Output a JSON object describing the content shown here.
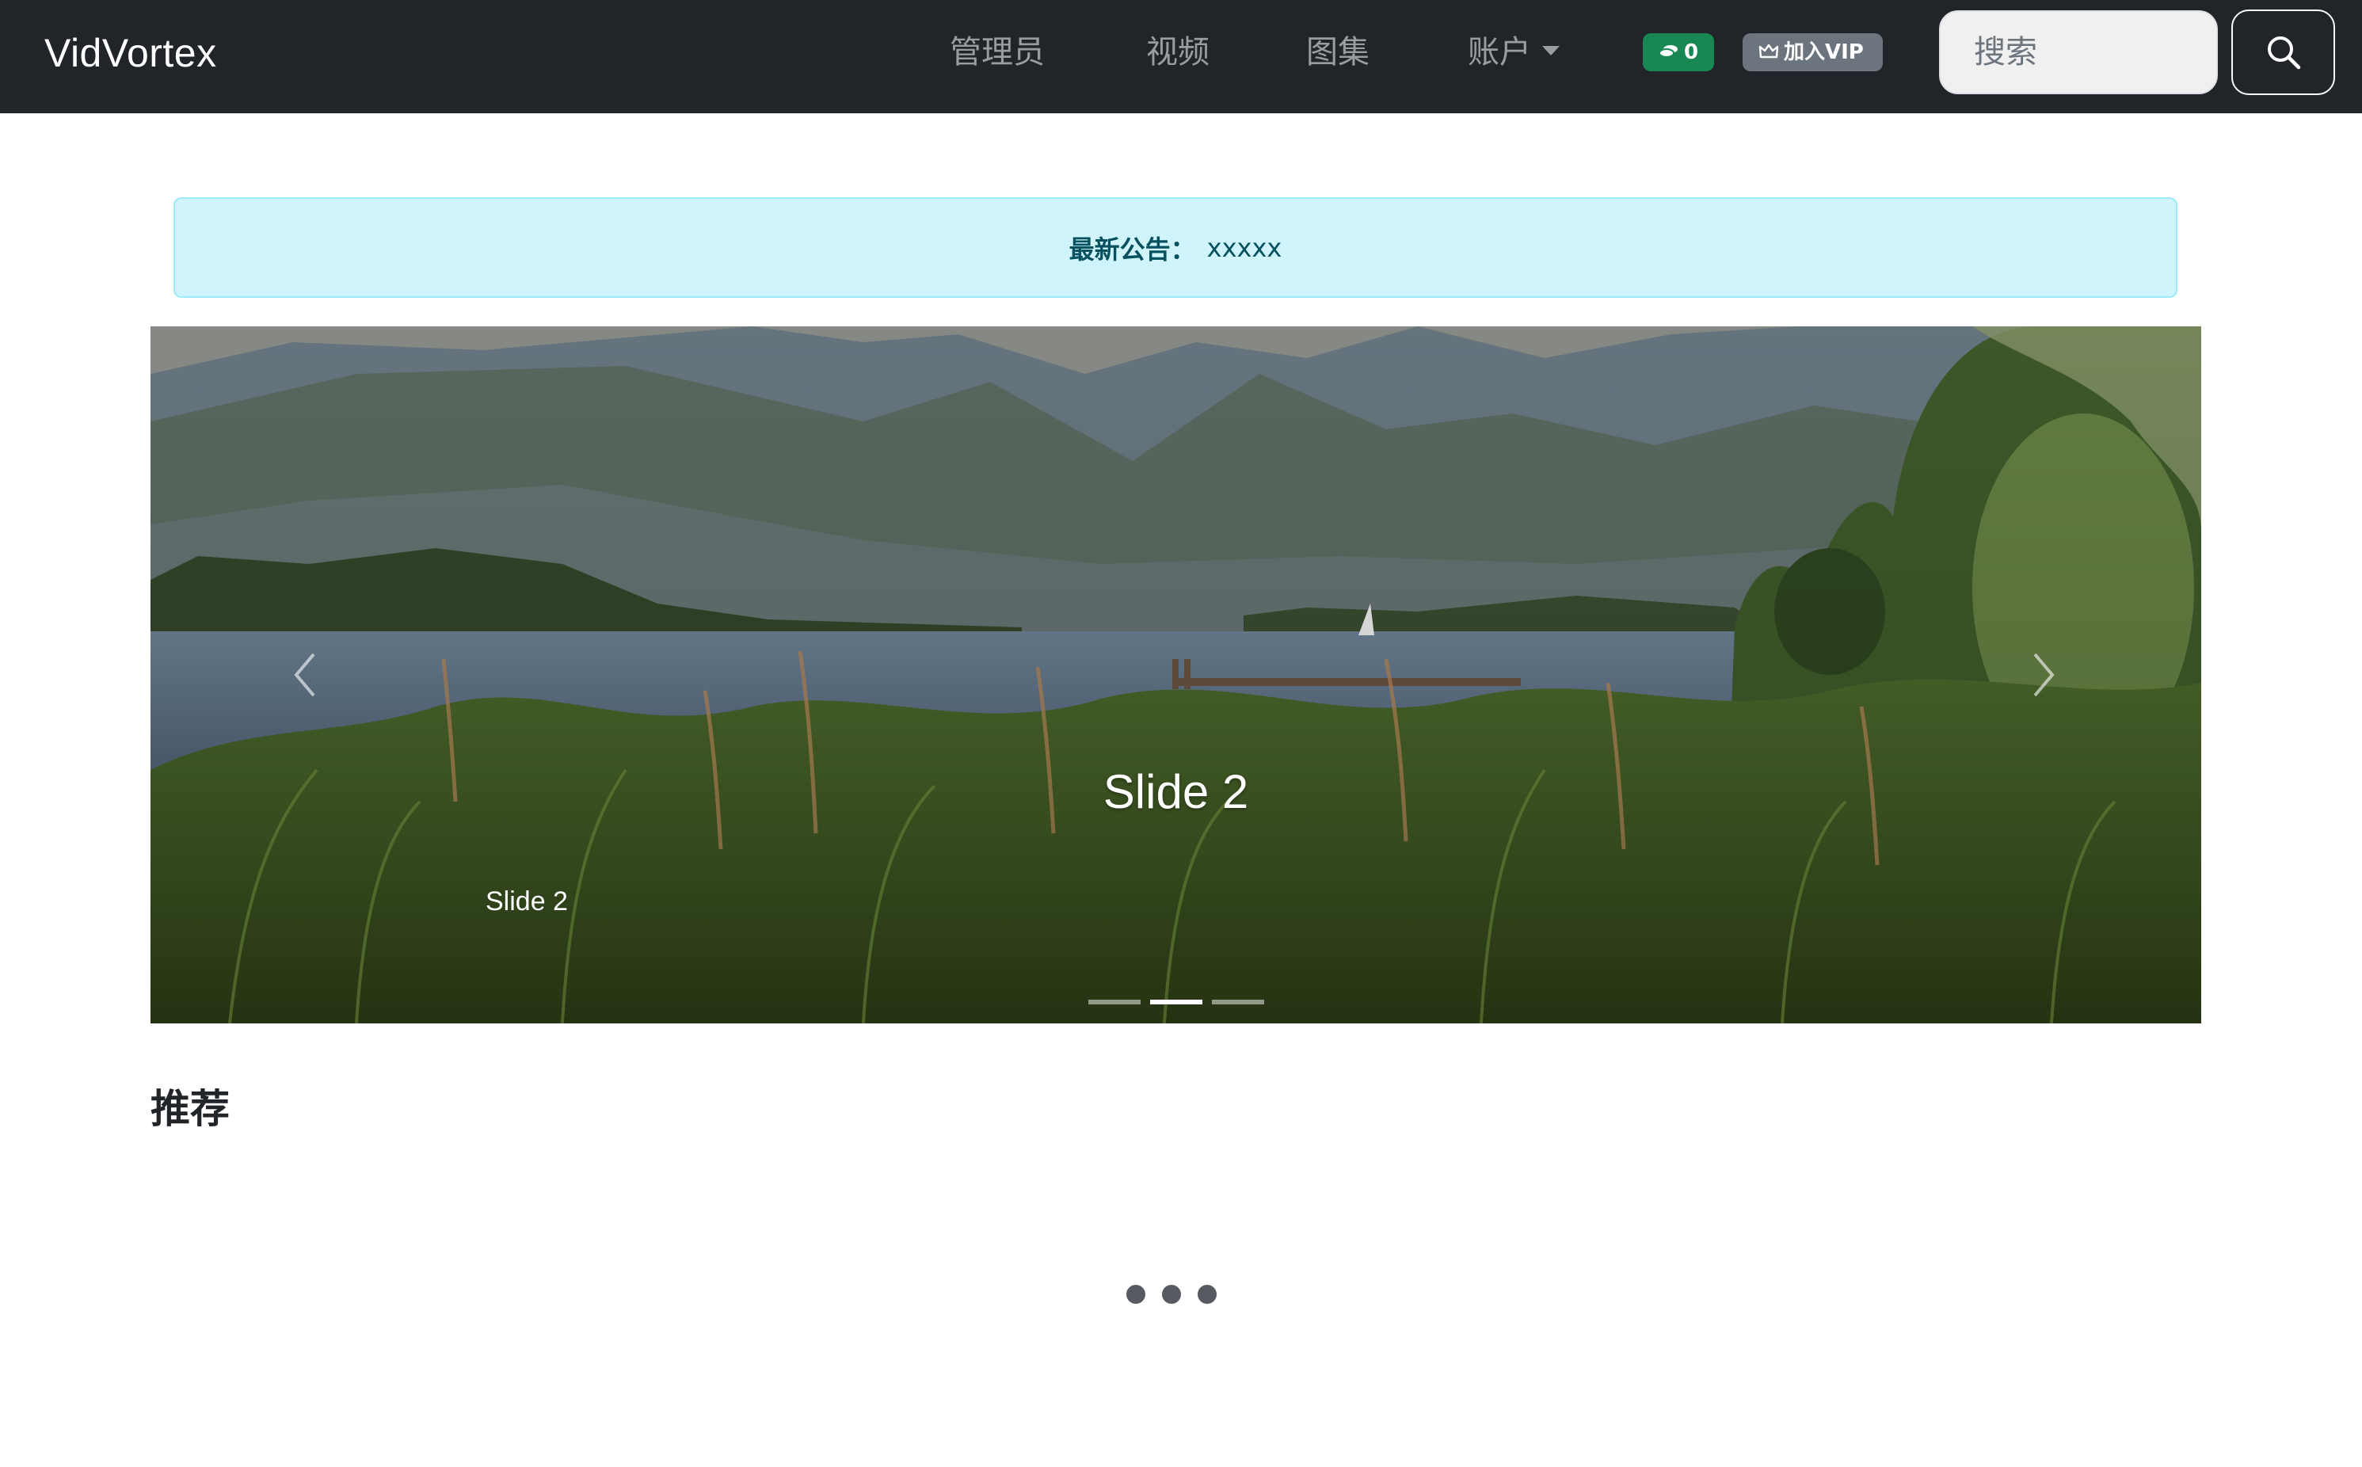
{
  "navbar": {
    "brand": "VidVortex",
    "items": [
      {
        "label": "管理员"
      },
      {
        "label": "视频"
      },
      {
        "label": "图集"
      },
      {
        "label": "账户"
      }
    ],
    "coins": "0",
    "vip_label": "加入VIP",
    "search_placeholder": "搜索",
    "coins_icon": "coins-icon",
    "vip_icon": "crown-icon",
    "search_icon": "search-icon"
  },
  "alert": {
    "label": "最新公告：",
    "text": "xxxxx"
  },
  "carousel": {
    "caption_title": "Slide 2",
    "caption_sub": "Slide 2",
    "slide_count": 3,
    "active_index": 1,
    "prev_icon": "chevron-left-icon",
    "next_icon": "chevron-right-icon"
  },
  "recommend": {
    "title": "推荐",
    "loading_icon": "loading-dots-icon"
  },
  "colors": {
    "navbar_bg": "#212529",
    "alert_bg": "#cff4fc",
    "coins_badge": "#198754",
    "vip_badge": "#6c757d"
  }
}
